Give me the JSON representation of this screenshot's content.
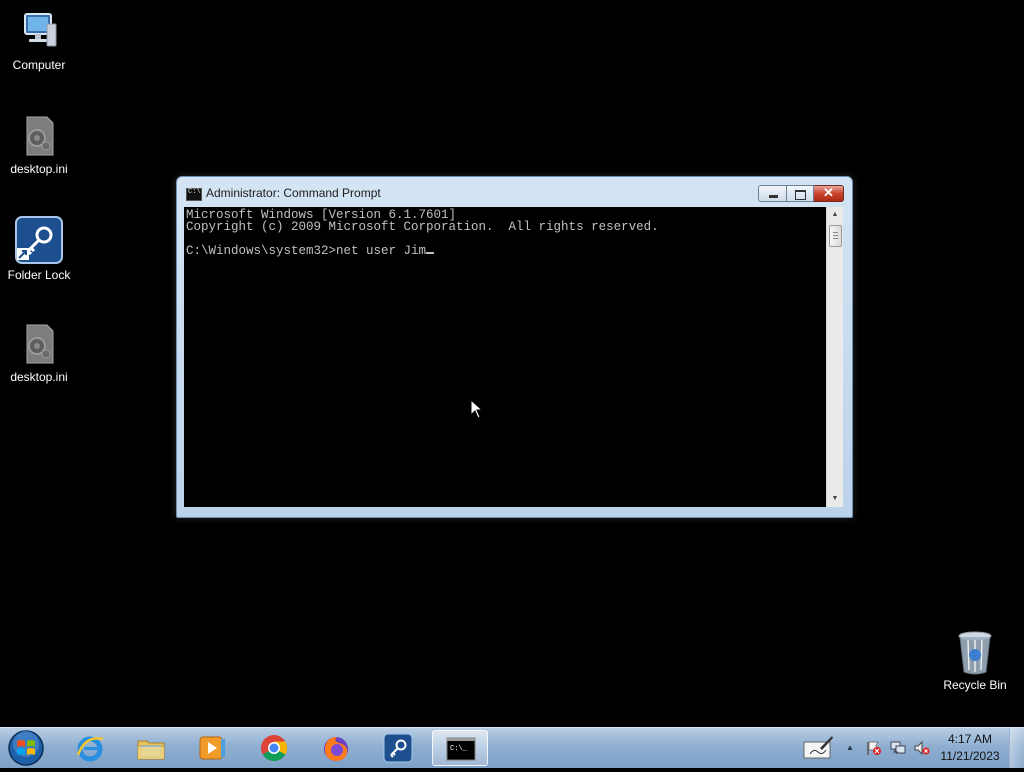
{
  "desktop": {
    "icons": [
      {
        "label": "Computer",
        "icon": "computer-icon"
      },
      {
        "label": "desktop.ini",
        "icon": "settings-file-icon"
      },
      {
        "label": "Folder Lock",
        "icon": "folder-lock-icon"
      },
      {
        "label": "desktop.ini",
        "icon": "settings-file-icon"
      },
      {
        "label": "Recycle Bin",
        "icon": "recycle-bin-icon"
      }
    ]
  },
  "window": {
    "title": "Administrator:  Command Prompt",
    "console_lines": [
      "Microsoft Windows [Version 6.1.7601]",
      "Copyright (c) 2009 Microsoft Corporation.  All rights reserved.",
      "",
      "C:\\Windows\\system32>net user Jim"
    ],
    "controls": {
      "minimize": "minimize",
      "maximize": "maximize",
      "close": "close"
    }
  },
  "taskbar": {
    "start": "start-orb-icon",
    "pinned": [
      "internet-explorer-icon",
      "windows-explorer-icon",
      "media-player-icon",
      "chrome-icon",
      "firefox-icon",
      "folder-lock-icon",
      "command-prompt-icon"
    ],
    "active_app": "command-prompt-icon",
    "tray": [
      "notepad-pen-icon",
      "show-hidden-icons-arrow",
      "action-center-flag-icon",
      "network-icon",
      "volume-muted-icon"
    ],
    "clock": {
      "time": "4:17 AM",
      "date": "11/21/2023"
    }
  },
  "colors": {
    "desktop": "#000000",
    "console_text": "#c0c0c0",
    "window_frame": "#c9dcef",
    "close_button": "#c9442f"
  }
}
